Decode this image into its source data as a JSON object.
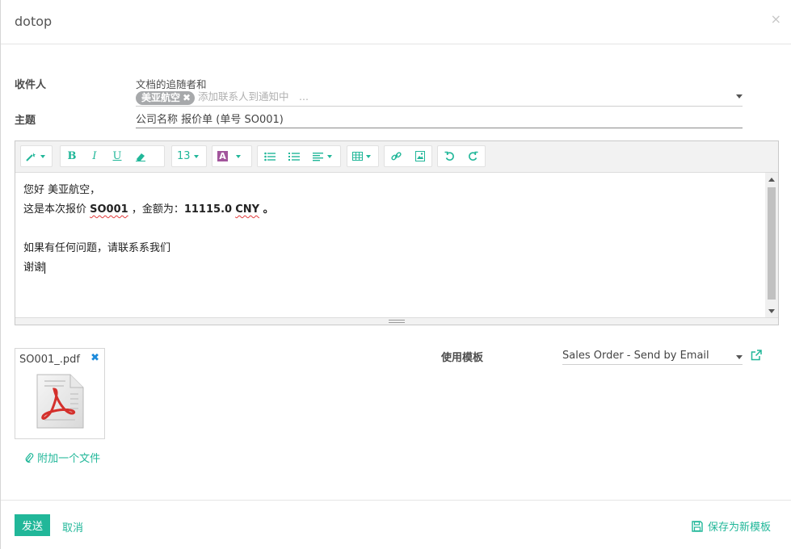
{
  "dialog": {
    "title": "dotop",
    "close_glyph": "×"
  },
  "form": {
    "recipients_label": "收件人",
    "recipients_hint": "文档的追随者和",
    "recipient_tag": "美亚航空",
    "recipient_tag_remove": "✖",
    "recipients_placeholder": "添加联系人到通知中　...",
    "subject_label": "主题",
    "subject_value": "公司名称 报价单 (单号 SO001)"
  },
  "toolbar": {
    "font_size": "13",
    "icons": [
      "magic-wand-icon",
      "bold-icon",
      "italic-icon",
      "underline-icon",
      "eraser-icon",
      "font-color-icon",
      "bullet-list-icon",
      "numbered-list-icon",
      "align-icon",
      "table-icon",
      "link-icon",
      "image-icon",
      "undo-icon",
      "redo-icon"
    ],
    "bold": "B",
    "italic": "I",
    "underline": "U",
    "color_letter": "A",
    "accent_color": "#21b799"
  },
  "body": {
    "line1": "您好 美亚航空，",
    "line2_prefix": "这是本次报价 ",
    "line2_order": "SO001",
    "line2_mid": " ，金额为：",
    "line2_amount": "11115.0",
    "line2_space": " ",
    "line2_currency": "CNY",
    "line2_end": " 。",
    "line4": "如果有任何问题，请联系系我们",
    "line5": "谢谢"
  },
  "attachment": {
    "file_name": "SO001_.pdf",
    "remove_glyph": "✖",
    "add_link": "附加一个文件",
    "icon": "pdf-file-icon"
  },
  "template": {
    "label": "使用模板",
    "selected": "Sales Order - Send by Email"
  },
  "footer": {
    "send": "发送",
    "cancel": "取消",
    "save_as_template": "保存为新模板"
  }
}
